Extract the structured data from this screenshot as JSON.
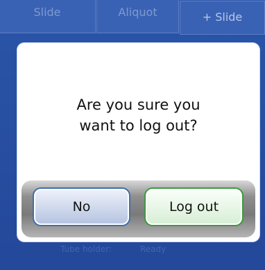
{
  "background": {
    "tabs": [
      "Slide",
      "Aliquot",
      "+ Slide"
    ],
    "status": {
      "label": "Tube holder:",
      "value": "Ready"
    }
  },
  "dialog": {
    "message_line1": "Are you sure you",
    "message_line2": "want to log out?",
    "no_label": "No",
    "logout_label": "Log out"
  },
  "colors": {
    "background": "#2c56a6",
    "no_border": "#3e6fae",
    "logout_border": "#3c9a3c"
  }
}
